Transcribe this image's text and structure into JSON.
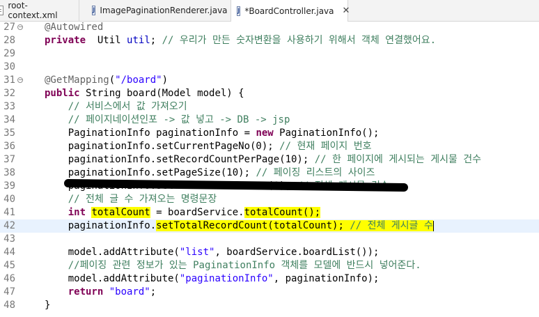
{
  "tabs": [
    {
      "label": "root-context.xml",
      "icon": "xml-file-icon"
    },
    {
      "label": "ImagePaginationRenderer.java",
      "icon": "java-file-icon"
    },
    {
      "label": "*BoardController.java",
      "icon": "java-file-icon",
      "close": "✕"
    }
  ],
  "lines": [
    {
      "n": "27",
      "tokens": [
        [
          "ann",
          "@Autowired"
        ]
      ]
    },
    {
      "n": "28",
      "tokens": [
        [
          "kw",
          "private"
        ],
        [
          "",
          "  Util "
        ],
        [
          "fld",
          "util"
        ],
        [
          "",
          "; "
        ],
        [
          "cmt",
          "// 우리가 만든 숫자변환을 사용하기 위해서 객체 연결했어요."
        ]
      ]
    },
    {
      "n": "29",
      "tokens": []
    },
    {
      "n": "30",
      "tokens": []
    },
    {
      "n": "31",
      "tokens": [
        [
          "ann",
          "@GetMapping"
        ],
        [
          "",
          "("
        ],
        [
          "str",
          "\"/board\""
        ],
        [
          "",
          ")"
        ]
      ]
    },
    {
      "n": "32",
      "tokens": [
        [
          "kw",
          "public"
        ],
        [
          "",
          " String board(Model model) {"
        ]
      ]
    },
    {
      "n": "33",
      "tokens": [
        [
          "",
          "    "
        ],
        [
          "cmt",
          "// 서비스에서 값 가져오기"
        ]
      ]
    },
    {
      "n": "34",
      "tokens": [
        [
          "",
          "    "
        ],
        [
          "cmt",
          "// 페이지네이션인포 -> 값 넣고 -> DB -> jsp"
        ]
      ]
    },
    {
      "n": "35",
      "tokens": [
        [
          "",
          "    PaginationInfo paginationInfo = "
        ],
        [
          "kw",
          "new"
        ],
        [
          "",
          " PaginationInfo();"
        ]
      ]
    },
    {
      "n": "36",
      "tokens": [
        [
          "",
          "    paginationInfo.setCurrentPageNo(0); "
        ],
        [
          "cmt",
          "// 현재 페이지 번호"
        ]
      ]
    },
    {
      "n": "37",
      "tokens": [
        [
          "",
          "    paginationInfo.setRecordCountPerPage(10); "
        ],
        [
          "cmt",
          "// 한 페이지에 게시되는 게시물 건수"
        ]
      ]
    },
    {
      "n": "38",
      "tokens": [
        [
          "",
          "    paginationInfo.setPageSize(10); "
        ],
        [
          "cmt",
          "// 페이징 리스트의 사이즈"
        ]
      ]
    },
    {
      "n": "39",
      "tokens": [
        [
          "",
          "    paginationInfo.setTotalRecordCount(0); "
        ],
        [
          "cmt",
          "// 전체 게시물 건수"
        ]
      ]
    },
    {
      "n": "40",
      "tokens": [
        [
          "",
          "    "
        ],
        [
          "cmt",
          "// 전체 글 수 가져오는 명령문장"
        ]
      ]
    },
    {
      "n": "41",
      "tokens": [
        [
          "",
          "    "
        ],
        [
          "kw",
          "int"
        ],
        [
          "",
          " "
        ],
        [
          "mark",
          "totalCount"
        ],
        [
          "",
          " = boardService."
        ],
        [
          "mark",
          "totalCount"
        ],
        [
          "mark",
          "();"
        ]
      ]
    },
    {
      "n": "42",
      "tokens": [
        [
          "",
          "    paginationInfo."
        ],
        [
          "mark",
          "setTotalRecordCount(totalCount); "
        ],
        [
          "markcmt",
          "// 전체 게시글 수"
        ]
      ]
    },
    {
      "n": "43",
      "tokens": []
    },
    {
      "n": "44",
      "tokens": [
        [
          "",
          "    model.addAttribute("
        ],
        [
          "str",
          "\"list\""
        ],
        [
          "",
          ", boardService.boardList());"
        ]
      ]
    },
    {
      "n": "45",
      "tokens": [
        [
          "",
          "    "
        ],
        [
          "cmt",
          "//페이징 관련 정보가 있는 PaginationInfo 객체를 모델에 반드시 넣어준다."
        ]
      ]
    },
    {
      "n": "46",
      "tokens": [
        [
          "",
          "    model.addAttribute("
        ],
        [
          "str",
          "\"paginationInfo\""
        ],
        [
          "",
          ", paginationInfo);"
        ]
      ]
    },
    {
      "n": "47",
      "tokens": [
        [
          "",
          "    "
        ],
        [
          "kw",
          "return"
        ],
        [
          "",
          " "
        ],
        [
          "str",
          "\"board\""
        ],
        [
          "",
          ";"
        ]
      ]
    },
    {
      "n": "48",
      "tokens": [
        [
          "",
          "}"
        ]
      ]
    }
  ],
  "current_line": "42"
}
